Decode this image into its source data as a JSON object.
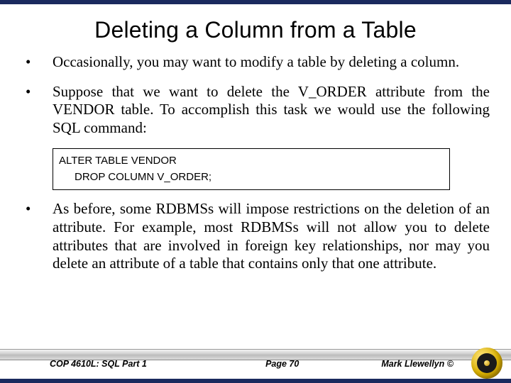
{
  "title": "Deleting a Column from a Table",
  "bullets": {
    "b1": "Occasionally, you may want to modify a table by deleting a column.",
    "b2": "Suppose that we want to delete the V_ORDER attribute from the VENDOR table.  To accomplish this task we would use the following SQL command:",
    "b3": "As before, some RDBMSs will impose restrictions on the deletion of an attribute. For example, most RDBMSs will not allow you to delete attributes that are involved in foreign key relationships, nor may you delete an attribute of a table that contains only that one attribute."
  },
  "code": {
    "line1": "ALTER TABLE  VENDOR",
    "line2": "DROP COLUMN V_ORDER;"
  },
  "footer": {
    "course": "COP 4610L: SQL Part 1",
    "page": "Page 70",
    "author": "Mark Llewellyn ©"
  }
}
